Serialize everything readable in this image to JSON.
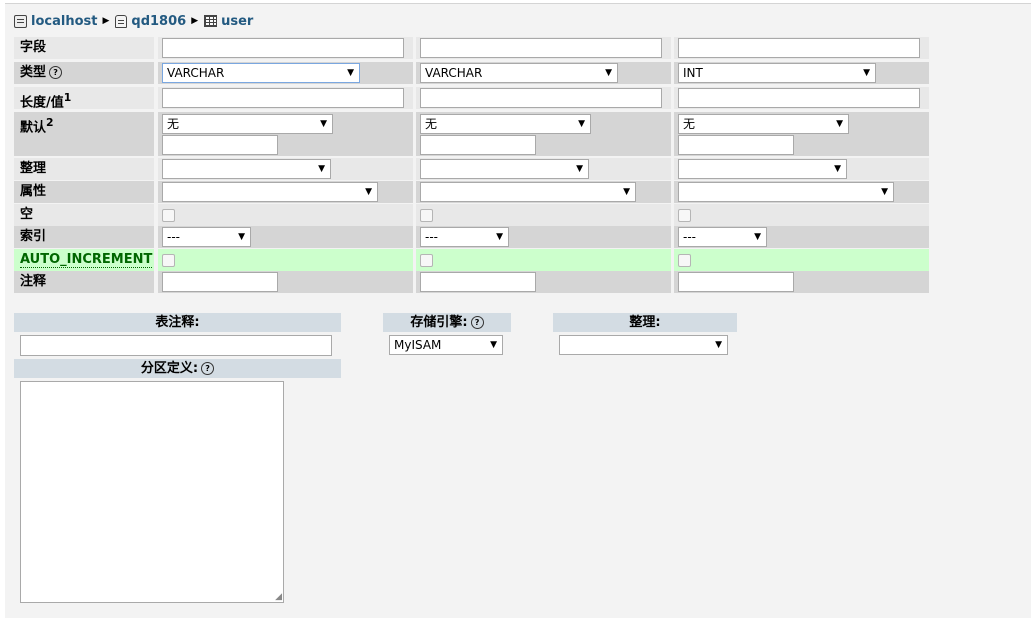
{
  "breadcrumb": {
    "server": "localhost",
    "database": "qd1806",
    "table": "user",
    "separator": "▶"
  },
  "rows": {
    "field": {
      "label": "字段"
    },
    "type": {
      "label": "类型",
      "values": [
        "VARCHAR",
        "VARCHAR",
        "INT"
      ]
    },
    "length": {
      "label": "长度/值",
      "sup": "1"
    },
    "default": {
      "label": "默认",
      "sup": "2",
      "values": [
        "无",
        "无",
        "无"
      ]
    },
    "collation": {
      "label": "整理"
    },
    "attributes": {
      "label": "属性"
    },
    "null": {
      "label": "空"
    },
    "index": {
      "label": "索引",
      "values": [
        "---",
        "---",
        "---"
      ]
    },
    "auto_increment": {
      "label": "AUTO_INCREMENT"
    },
    "comment": {
      "label": "注释"
    }
  },
  "table_options": {
    "comment_header": "表注释:",
    "engine_header": "存储引擎:",
    "engine_value": "MyISAM",
    "collation_header": "整理:",
    "partition_header": "分区定义:"
  },
  "icons": {
    "help": "?",
    "dropdown": "▼"
  }
}
